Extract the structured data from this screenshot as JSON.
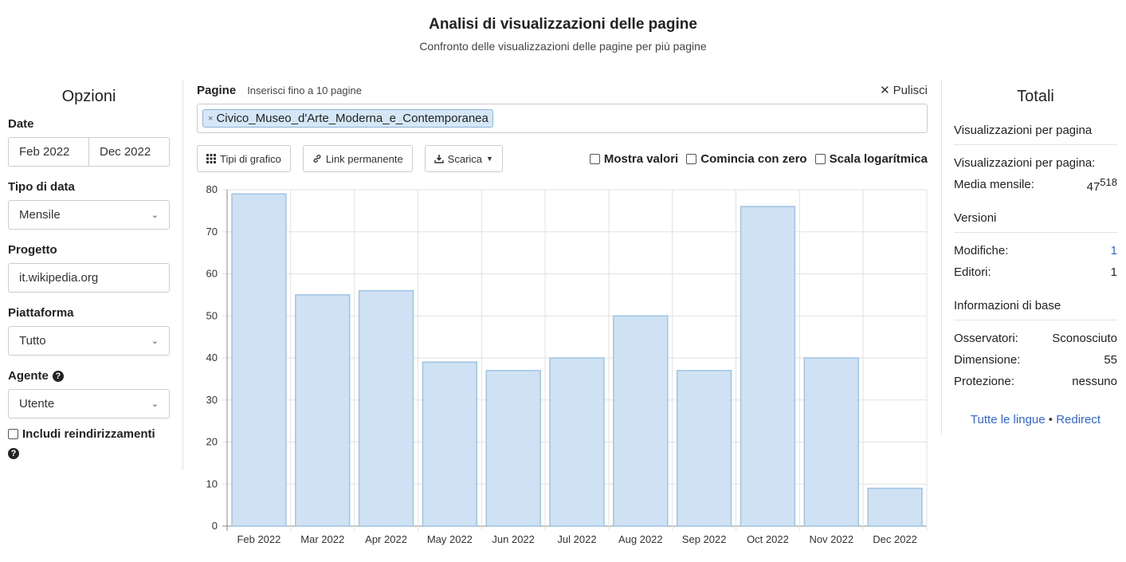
{
  "header": {
    "title": "Analisi di visualizzazioni delle pagine",
    "subtitle": "Confronto delle visualizzazioni delle pagine per più pagine"
  },
  "options": {
    "title": "Opzioni",
    "date_label": "Date",
    "date_start": "Feb 2022",
    "date_end": "Dec 2022",
    "date_type_label": "Tipo di data",
    "date_type_value": "Mensile",
    "project_label": "Progetto",
    "project_value": "it.wikipedia.org",
    "platform_label": "Piattaforma",
    "platform_value": "Tutto",
    "agent_label": "Agente",
    "agent_value": "Utente",
    "redirects_label": "Includi reindirizzamenti"
  },
  "pages": {
    "label": "Pagine",
    "hint": "Inserisci fino a 10 pagine",
    "clear_label": "Pulisci",
    "tags": [
      "Civico_Museo_d'Arte_Moderna_e_Contemporanea"
    ]
  },
  "toolbar": {
    "chart_types": "Tipi di grafico",
    "permalink": "Link permanente",
    "download": "Scarica",
    "show_values": "Mostra valori",
    "begin_zero": "Comincia con zero",
    "log_scale": "Scala logarítmica"
  },
  "chart_data": {
    "type": "bar",
    "categories": [
      "Feb 2022",
      "Mar 2022",
      "Apr 2022",
      "May 2022",
      "Jun 2022",
      "Jul 2022",
      "Aug 2022",
      "Sep 2022",
      "Oct 2022",
      "Nov 2022",
      "Dec 2022"
    ],
    "values": [
      79,
      55,
      56,
      39,
      37,
      40,
      50,
      37,
      76,
      40,
      9
    ],
    "ylim": [
      0,
      80
    ],
    "yticks": [
      0,
      10,
      20,
      30,
      40,
      50,
      60,
      70,
      80
    ],
    "grid": true,
    "bar_color": "#cfe2f3",
    "bar_border": "#9fc3e4"
  },
  "totals": {
    "title": "Totali",
    "views_section": "Visualizzazioni per pagina",
    "views_label": "Visualizzazioni per pagina:",
    "monthly_label": "Media mensile:",
    "monthly_value": "47",
    "monthly_sup": "518",
    "versions_section": "Versioni",
    "edits_label": "Modifiche:",
    "edits_value": "1",
    "editors_label": "Editori:",
    "editors_value": "1",
    "info_section": "Informazioni di base",
    "watchers_label": "Osservatori:",
    "watchers_value": "Sconosciuto",
    "size_label": "Dimensione:",
    "size_value": "55",
    "protection_label": "Protezione:",
    "protection_value": "nessuno",
    "all_languages": "Tutte le lingue",
    "separator": "•",
    "redirect": "Redirect"
  }
}
